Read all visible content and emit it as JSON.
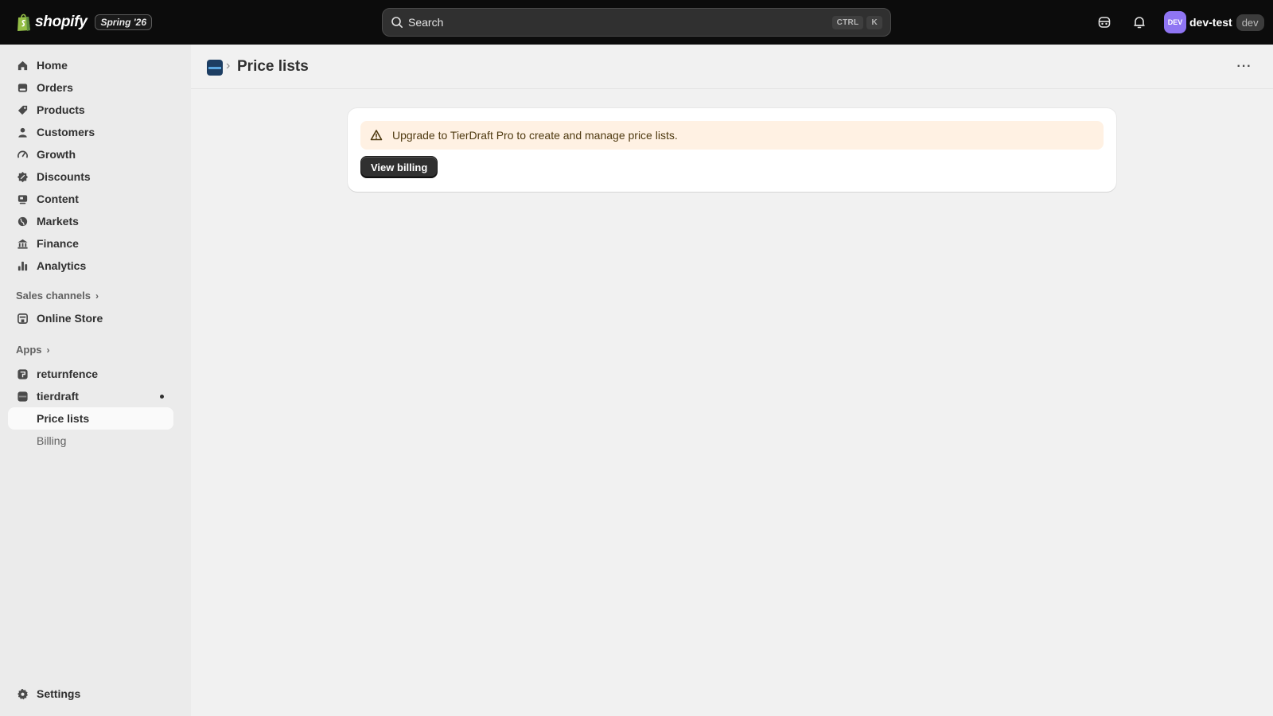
{
  "topbar": {
    "brand": "shopify",
    "badge": "Spring '26",
    "search": {
      "placeholder": "Search",
      "shortcut": [
        "CTRL",
        "K"
      ]
    },
    "icons": [
      "support-icon",
      "bell-icon"
    ],
    "account": {
      "initials": "DEV",
      "name": "dev-test",
      "tag": "dev",
      "avatar_color": "#8f75f3"
    }
  },
  "sidebar": {
    "items": [
      {
        "label": "Home",
        "icon": "home-icon"
      },
      {
        "label": "Orders",
        "icon": "orders-icon"
      },
      {
        "label": "Products",
        "icon": "tag-icon"
      },
      {
        "label": "Customers",
        "icon": "person-icon"
      },
      {
        "label": "Growth",
        "icon": "gauge-icon"
      },
      {
        "label": "Discounts",
        "icon": "discount-icon"
      },
      {
        "label": "Content",
        "icon": "content-icon"
      },
      {
        "label": "Markets",
        "icon": "globe-icon"
      },
      {
        "label": "Finance",
        "icon": "bank-icon"
      },
      {
        "label": "Analytics",
        "icon": "bar-chart-icon"
      }
    ],
    "sales_channels": {
      "label": "Sales channels",
      "items": [
        {
          "label": "Online Store",
          "icon": "store-icon"
        }
      ]
    },
    "apps": {
      "label": "Apps",
      "items": [
        {
          "label": "returnfence",
          "icon": "returnfence-app-icon"
        },
        {
          "label": "tierdraft",
          "icon": "tierdraft-app-icon"
        }
      ],
      "subitems": [
        {
          "label": "Price lists",
          "active": true
        },
        {
          "label": "Billing",
          "active": false
        }
      ]
    },
    "settings": {
      "label": "Settings",
      "icon": "gear-icon"
    }
  },
  "page": {
    "title": "Price lists",
    "banner": {
      "message": "Upgrade to TierDraft Pro to create and manage price lists.",
      "tone_color": "#fff1e3"
    },
    "button": "View billing"
  }
}
